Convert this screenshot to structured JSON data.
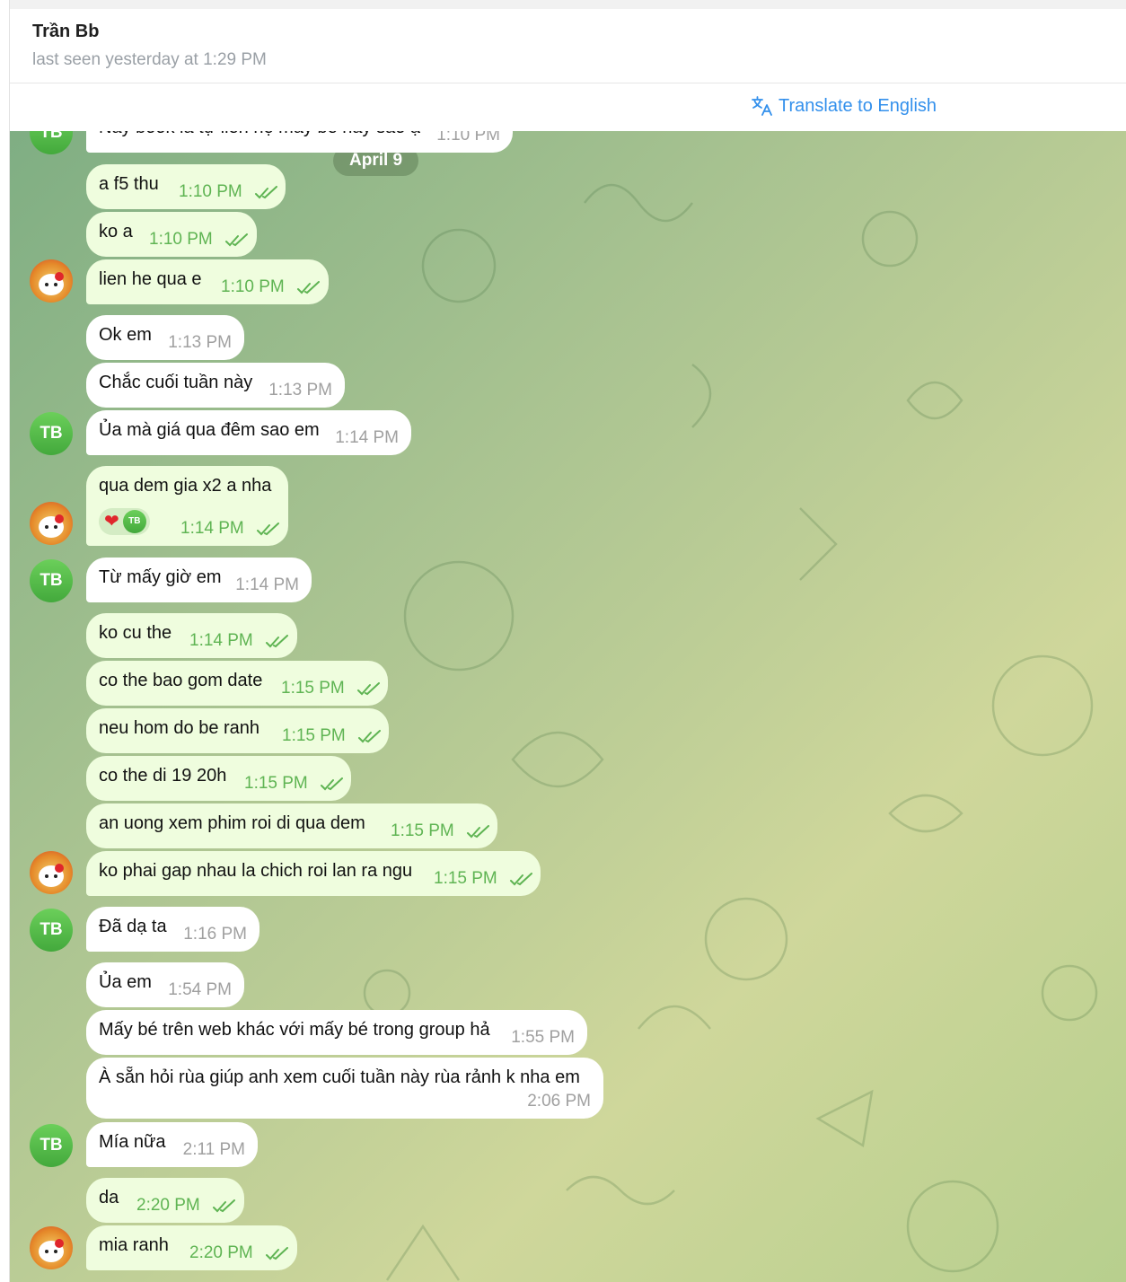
{
  "header": {
    "name": "Trần Bb",
    "status": "last seen yesterday at 1:29 PM"
  },
  "translate": {
    "label": "Translate to English"
  },
  "date_chip": "April 9",
  "avatars": {
    "tb_initials": "TB"
  },
  "messages": [
    {
      "text": "Này book là tự liên hệ mấy bé hay sao ạ",
      "time": "1:10 PM",
      "dir": "in"
    },
    {
      "text": "a f5 thu",
      "time": "1:10 PM",
      "dir": "out",
      "read": true
    },
    {
      "text": "ko a",
      "time": "1:10 PM",
      "dir": "out",
      "read": true
    },
    {
      "text": "lien he qua e",
      "time": "1:10 PM",
      "dir": "out",
      "read": true
    },
    {
      "text": "Ok em",
      "time": "1:13 PM",
      "dir": "in"
    },
    {
      "text": "Chắc cuối tuần này",
      "time": "1:13 PM",
      "dir": "in"
    },
    {
      "text": "Ủa mà giá qua đêm sao em",
      "time": "1:14 PM",
      "dir": "in"
    },
    {
      "text": "qua dem gia x2 a nha",
      "time": "1:14 PM",
      "dir": "out",
      "read": true,
      "reaction": "❤",
      "reaction_user": "TB"
    },
    {
      "text": "Từ mấy giờ em",
      "time": "1:14 PM",
      "dir": "in"
    },
    {
      "text": "ko cu the",
      "time": "1:14 PM",
      "dir": "out",
      "read": true
    },
    {
      "text": "co the bao gom date",
      "time": "1:15 PM",
      "dir": "out",
      "read": true
    },
    {
      "text": "neu hom do be ranh",
      "time": "1:15 PM",
      "dir": "out",
      "read": true
    },
    {
      "text": "co the di 19 20h",
      "time": "1:15 PM",
      "dir": "out",
      "read": true
    },
    {
      "text": "an uong xem phim roi di qua dem",
      "time": "1:15 PM",
      "dir": "out",
      "read": true
    },
    {
      "text": "ko phai gap nhau la chich roi lan ra ngu",
      "time": "1:15 PM",
      "dir": "out",
      "read": true
    },
    {
      "text": "Đã dạ ta",
      "time": "1:16 PM",
      "dir": "in"
    },
    {
      "text": "Ủa em",
      "time": "1:54 PM",
      "dir": "in"
    },
    {
      "text": "Mấy bé trên web khác với mấy bé trong group hả",
      "time": "1:55 PM",
      "dir": "in"
    },
    {
      "text": "À sẵn hỏi rùa giúp anh xem cuối tuần này rùa rảnh k nha em",
      "time": "2:06 PM",
      "dir": "in"
    },
    {
      "text": "Mía nữa",
      "time": "2:11 PM",
      "dir": "in"
    },
    {
      "text": "da",
      "time": "2:20 PM",
      "dir": "out",
      "read": true
    },
    {
      "text": "mia ranh",
      "time": "2:20 PM",
      "dir": "out",
      "read": true
    }
  ]
}
